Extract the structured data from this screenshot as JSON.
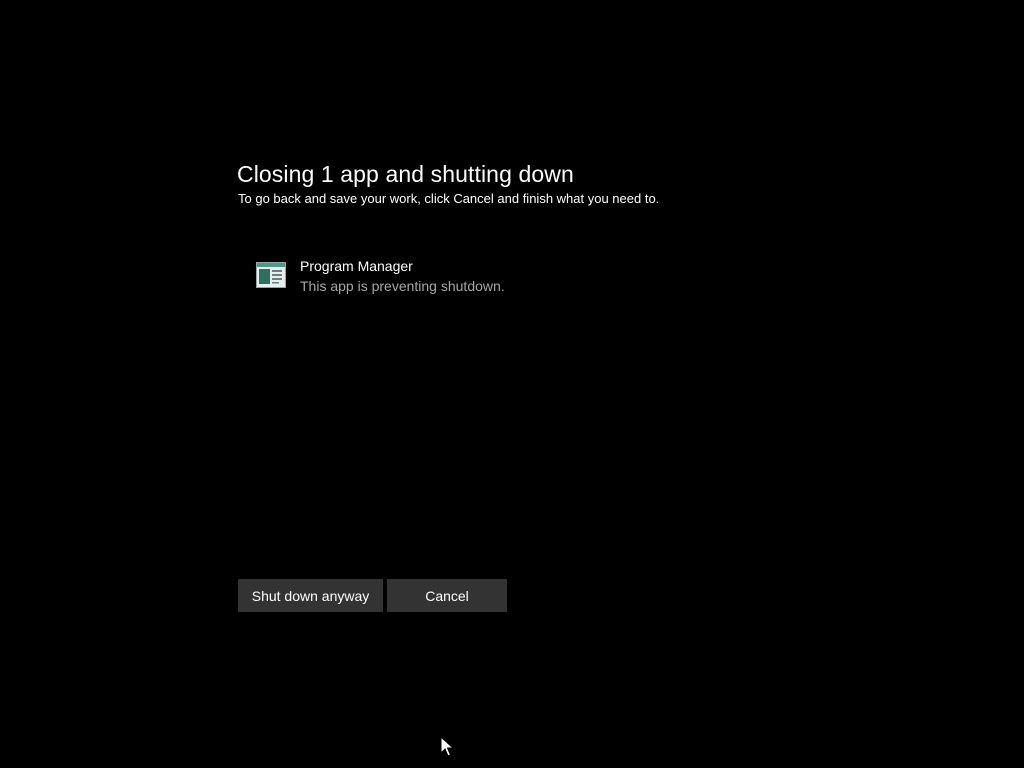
{
  "dialog": {
    "title": "Closing 1 app and shutting down",
    "subtitle": "To go back and save your work, click Cancel and finish what you need to."
  },
  "apps": [
    {
      "name": "Program Manager",
      "status": "This app is preventing shutdown.",
      "icon": "program-window-icon"
    }
  ],
  "buttons": {
    "shutdown_label": "Shut down anyway",
    "cancel_label": "Cancel"
  },
  "colors": {
    "background": "#000000",
    "text": "#ffffff",
    "muted_text": "#a6a6a6",
    "button_bg": "#333333"
  }
}
